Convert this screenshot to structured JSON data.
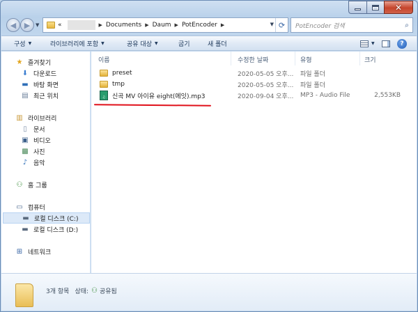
{
  "address": {
    "prefix": "«",
    "crumbs": [
      "Documents",
      "Daum",
      "PotEncoder"
    ]
  },
  "search": {
    "placeholder": "PotEncoder 검색"
  },
  "toolbar": {
    "organize": "구성",
    "include_library": "라이브러리에 포함",
    "share": "공유 대상",
    "burn": "굽기",
    "new_folder": "새 폴더"
  },
  "nav": {
    "favorites": "즐겨찾기",
    "downloads": "다운로드",
    "desktop": "바탕 화면",
    "recent": "최근 위치",
    "libraries": "라이브러리",
    "documents": "문서",
    "videos": "비디오",
    "pictures": "사진",
    "music": "음악",
    "homegroup": "홈 그룹",
    "computer": "컴퓨터",
    "local_c": "로컬 디스크 (C:)",
    "local_d": "로컬 디스크 (D:)",
    "network": "네트워크"
  },
  "columns": {
    "name": "이름",
    "modified": "수정한 날짜",
    "type": "유형",
    "size": "크기"
  },
  "files": [
    {
      "name": "preset",
      "modified": "2020-05-05 오후...",
      "type": "파일 폴더",
      "size": ""
    },
    {
      "name": "tmp",
      "modified": "2020-05-05 오후...",
      "type": "파일 폴더",
      "size": ""
    },
    {
      "name": "신곡 MV 아이유 eight(에잇).mp3",
      "modified": "2020-09-04 오후...",
      "type": "MP3 - Audio File",
      "size": "2,553KB"
    }
  ],
  "details": {
    "count": "3개 항목",
    "state_label": "상태:",
    "state_value": "공유됨"
  },
  "colors": {
    "accent": "#3a67a6",
    "selection": "#dce9f8",
    "annotation": "#e0101a"
  }
}
